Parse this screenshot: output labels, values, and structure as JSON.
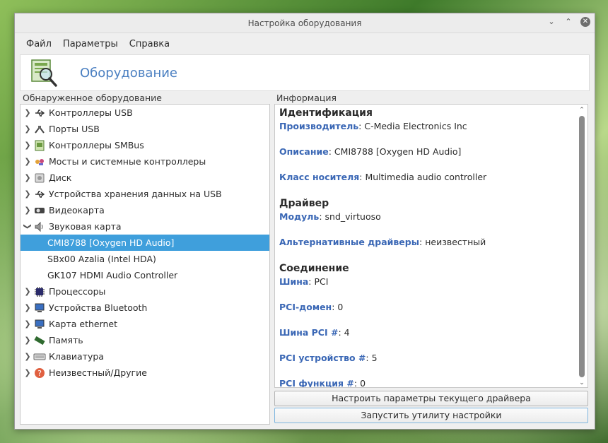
{
  "window": {
    "title": "Настройка оборудования"
  },
  "menu": [
    "Файл",
    "Параметры",
    "Справка"
  ],
  "header": {
    "title": "Оборудование"
  },
  "left_label": "Обнаруженное оборудование",
  "right_label": "Информация",
  "tree": [
    {
      "label": "Контроллеры USB",
      "icon": "usb-icon",
      "expanded": false
    },
    {
      "label": "Порты USB",
      "icon": "usb-port-icon",
      "expanded": false
    },
    {
      "label": "Контроллеры SMBus",
      "icon": "smbus-icon",
      "expanded": false
    },
    {
      "label": "Мосты и системные контроллеры",
      "icon": "bridge-icon",
      "expanded": false
    },
    {
      "label": "Диск",
      "icon": "disk-icon",
      "expanded": false
    },
    {
      "label": "Устройства хранения данных на USB",
      "icon": "usb-storage-icon",
      "expanded": false
    },
    {
      "label": "Видеокарта",
      "icon": "video-card-icon",
      "expanded": false
    },
    {
      "label": "Звуковая карта",
      "icon": "speaker-icon",
      "expanded": true
    },
    {
      "label": "CMI8788 [Oxygen HD Audio]",
      "child": true,
      "selected": true
    },
    {
      "label": "SBx00 Azalia (Intel HDA)",
      "child": true
    },
    {
      "label": "GK107 HDMI Audio Controller",
      "child": true
    },
    {
      "label": "Процессоры",
      "icon": "cpu-icon",
      "expanded": false
    },
    {
      "label": "Устройства Bluetooth",
      "icon": "bluetooth-icon",
      "expanded": false
    },
    {
      "label": "Карта ethernet",
      "icon": "ethernet-icon",
      "expanded": false
    },
    {
      "label": "Память",
      "icon": "memory-icon",
      "expanded": false
    },
    {
      "label": "Клавиатура",
      "icon": "keyboard-icon",
      "expanded": false
    },
    {
      "label": "Неизвестный/Другие",
      "icon": "unknown-icon",
      "expanded": false
    }
  ],
  "info": {
    "identification_title": "Идентификация",
    "vendor_key": "Производитель",
    "vendor_val": ": C-Media Electronics Inc",
    "desc_key": "Описание",
    "desc_val": ": CMI8788 [Oxygen HD Audio]",
    "class_key": "Класс носителя",
    "class_val": ": Multimedia audio controller",
    "driver_title": "Драйвер",
    "module_key": "Модуль",
    "module_val": ": snd_virtuoso",
    "alt_key": "Альтернативные драйверы",
    "alt_val": ": неизвестный",
    "connection_title": "Соединение",
    "bus_key": "Шина",
    "bus_val": ": PCI",
    "domain_key": "PCI-домен",
    "domain_val": ": 0",
    "pcibus_key": "Шина PCI #",
    "pcibus_val": ": 4",
    "pcidev_key": "PCI устройство #",
    "pcidev_val": ": 5",
    "pcifunc_key": "PCI функция #",
    "pcifunc_val": ": 0"
  },
  "buttons": {
    "configure_driver": "Настроить параметры текущего драйвера",
    "run_tool": "Запустить утилиту настройки"
  }
}
